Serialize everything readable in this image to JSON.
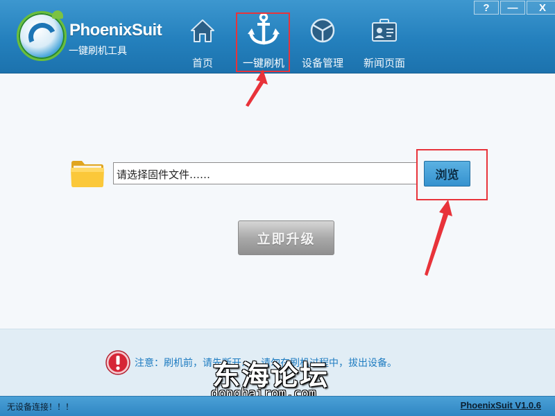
{
  "window": {
    "controls": {
      "help": "?",
      "minimize": "—",
      "close": "X"
    }
  },
  "brand": {
    "title": "PhoenixSuit",
    "subtitle": "一键刷机工具"
  },
  "nav": {
    "items": [
      {
        "label": "首页",
        "icon": "home-icon"
      },
      {
        "label": "一键刷机",
        "icon": "anchor-icon",
        "selected": true
      },
      {
        "label": "设备管理",
        "icon": "device-manager-icon"
      },
      {
        "label": "新闻页面",
        "icon": "news-card-icon"
      }
    ]
  },
  "main": {
    "firmware_input": {
      "value": "请选择固件文件……"
    },
    "browse_label": "浏览",
    "upgrade_label": "立即升级",
    "notice": "注意：刷机前，请先断开……请勿在刷机过程中，拔出设备。"
  },
  "watermark": {
    "cn": "东海论坛",
    "en": "donghairom.com"
  },
  "status": {
    "left": "无设备连接！！！",
    "right": "PhoenixSuit V1.0.6"
  },
  "colors": {
    "header": "#2480bd",
    "highlight": "#e8333a",
    "browse": "#3592cf",
    "notice_text": "#1e7cc1"
  }
}
